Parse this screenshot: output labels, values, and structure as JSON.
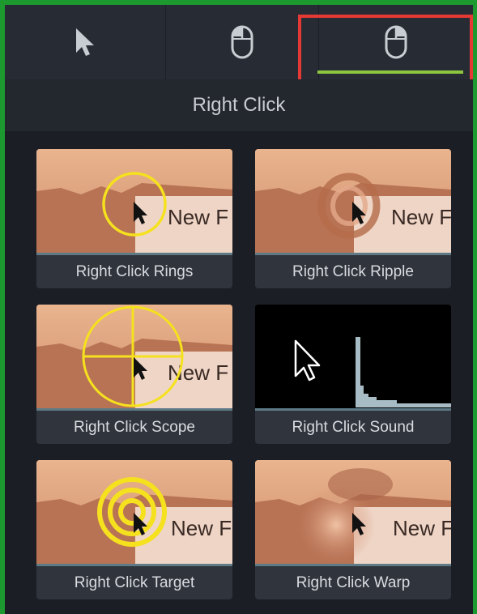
{
  "tabs": [
    {
      "icon": "cursor-arrow-icon"
    },
    {
      "icon": "mouse-left-click-icon"
    },
    {
      "icon": "mouse-right-click-icon",
      "selected": true
    }
  ],
  "section": {
    "title": "Right Click"
  },
  "preview_text": "New F",
  "effects": [
    {
      "label": "Right Click Rings"
    },
    {
      "label": "Right Click Ripple"
    },
    {
      "label": "Right Click Scope"
    },
    {
      "label": "Right Click Sound"
    },
    {
      "label": "Right Click Target"
    },
    {
      "label": "Right Click Warp"
    }
  ],
  "colors": {
    "frame_border": "#1c9a2f",
    "tab_underline": "#8cc63f",
    "highlight_box": "#e53935",
    "effect_yellow": "#f5e11e",
    "panel_background": "#1b1e25"
  }
}
